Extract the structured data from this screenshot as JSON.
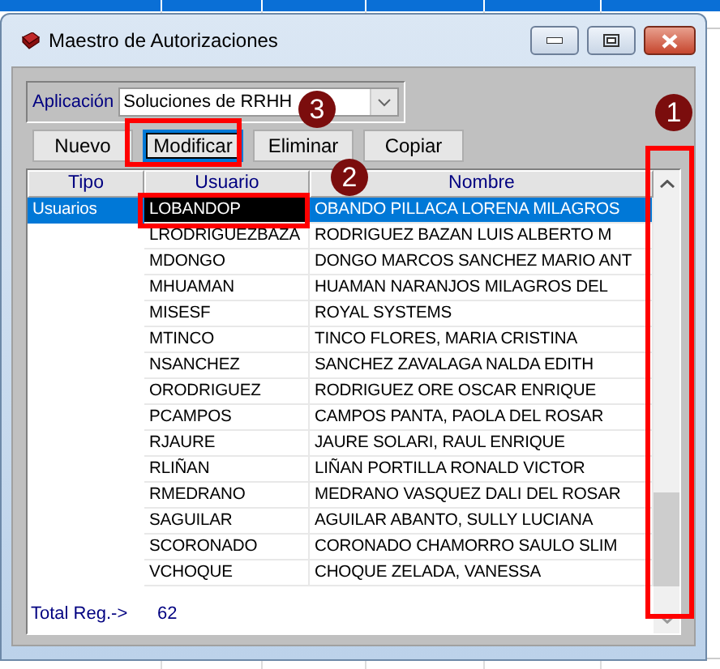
{
  "window": {
    "title": "Maestro de Autorizaciones"
  },
  "application": {
    "label": "Aplicación",
    "value": "Soluciones de RRHH"
  },
  "buttons": [
    {
      "label": "Nuevo",
      "selected": false
    },
    {
      "label": "Modificar",
      "selected": true
    },
    {
      "label": "Eliminar",
      "selected": false
    },
    {
      "label": "Copiar",
      "selected": false
    }
  ],
  "table": {
    "columns": [
      "Tipo",
      "Usuario",
      "Nombre"
    ],
    "rows": [
      {
        "tipo": "Usuarios",
        "usuario": "LOBANDOP",
        "nombre": "OBANDO PILLACA LORENA MILAGROS",
        "selected": true
      },
      {
        "usuario": "LRODRIGUEZBAZA",
        "nombre": "RODRIGUEZ BAZAN LUIS ALBERTO M",
        "selected": false
      },
      {
        "usuario": "MDONGO",
        "nombre": "DONGO MARCOS SANCHEZ MARIO ANT",
        "selected": false
      },
      {
        "usuario": "MHUAMAN",
        "nombre": "HUAMAN NARANJOS MILAGROS DEL",
        "selected": false
      },
      {
        "usuario": "MISESF",
        "nombre": "ROYAL SYSTEMS",
        "selected": false
      },
      {
        "usuario": "MTINCO",
        "nombre": "TINCO FLORES, MARIA  CRISTINA",
        "selected": false
      },
      {
        "usuario": "NSANCHEZ",
        "nombre": "SANCHEZ ZAVALAGA NALDA EDITH",
        "selected": false
      },
      {
        "usuario": "ORODRIGUEZ",
        "nombre": "RODRIGUEZ ORE OSCAR ENRIQUE",
        "selected": false
      },
      {
        "usuario": "PCAMPOS",
        "nombre": "CAMPOS PANTA, PAOLA  DEL ROSAR",
        "selected": false
      },
      {
        "usuario": "RJAURE",
        "nombre": "JAURE SOLARI, RAUL  ENRIQUE",
        "selected": false
      },
      {
        "usuario": "RLIÑAN",
        "nombre": "LIÑAN PORTILLA RONALD VICTOR",
        "selected": false
      },
      {
        "usuario": "RMEDRANO",
        "nombre": "MEDRANO VASQUEZ DALI DEL ROSAR",
        "selected": false
      },
      {
        "usuario": "SAGUILAR",
        "nombre": "AGUILAR ABANTO, SULLY LUCIANA",
        "selected": false
      },
      {
        "usuario": "SCORONADO",
        "nombre": "CORONADO CHAMORRO SAULO SLIM",
        "selected": false
      },
      {
        "usuario": "VCHOQUE",
        "nombre": "CHOQUE ZELADA, VANESSA",
        "selected": false
      }
    ]
  },
  "total": {
    "label": "Total Reg.->",
    "value": "62"
  },
  "annotations": [
    {
      "label": "1"
    },
    {
      "label": "2"
    },
    {
      "label": "3"
    }
  ]
}
